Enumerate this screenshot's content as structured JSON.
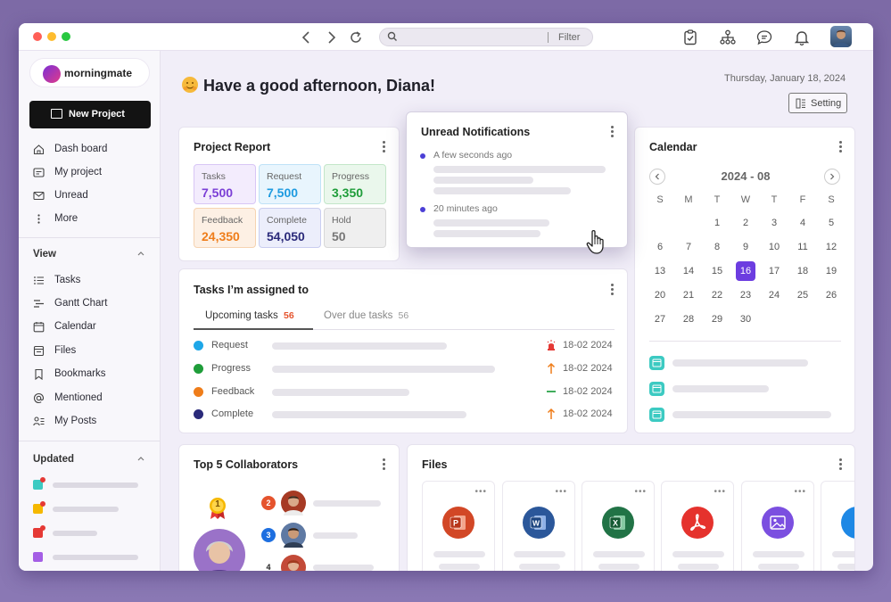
{
  "app": {
    "brand": "morningmate",
    "new_project_label": "New Project",
    "search_placeholder": "",
    "filter_label": "Filter"
  },
  "sidebar": {
    "items": [
      {
        "label": "Dash board",
        "icon": "home-icon"
      },
      {
        "label": "My project",
        "icon": "project-icon"
      },
      {
        "label": "Unread",
        "icon": "mail-icon"
      },
      {
        "label": "More",
        "icon": "more-vertical-icon"
      }
    ],
    "view_title": "View",
    "view_items": [
      {
        "label": "Tasks",
        "icon": "list-icon"
      },
      {
        "label": "Gantt Chart",
        "icon": "gantt-icon"
      },
      {
        "label": "Calendar",
        "icon": "calendar-icon"
      },
      {
        "label": "Files",
        "icon": "file-icon"
      },
      {
        "label": "Bookmarks",
        "icon": "bookmark-icon"
      },
      {
        "label": "Mentioned",
        "icon": "at-icon"
      },
      {
        "label": "My Posts",
        "icon": "posts-icon"
      }
    ],
    "updated_title": "Updated",
    "updated_colors": [
      "#3ccac2",
      "#f5b800",
      "#e53935",
      "#a45ee5"
    ]
  },
  "header": {
    "greeting": "Have a good afternoon, Diana!",
    "date": "Thursday, January 18, 2024",
    "setting_label": "Setting"
  },
  "project_report": {
    "title": "Project Report",
    "stats": [
      {
        "label": "Tasks",
        "value": "7,500",
        "color": "#7b3fd6",
        "bg": "#f3ecfd",
        "border": "#d8c6f5"
      },
      {
        "label": "Request",
        "value": "7,500",
        "color": "#1e9be0",
        "bg": "#e8f5fd",
        "border": "#bfe2f7"
      },
      {
        "label": "Progress",
        "value": "3,350",
        "color": "#1f9d3a",
        "bg": "#eaf7ec",
        "border": "#c3e6c9"
      },
      {
        "label": "Feedback",
        "value": "24,350",
        "color": "#ef7d1a",
        "bg": "#fdf0e4",
        "border": "#f6d3b1"
      },
      {
        "label": "Complete",
        "value": "54,050",
        "color": "#2a2a7a",
        "bg": "#eceefb",
        "border": "#c9cdf0"
      },
      {
        "label": "Hold",
        "value": "50",
        "color": "#777777",
        "bg": "#efefef",
        "border": "#d8d8d8"
      }
    ]
  },
  "notifications": {
    "title": "Unread Notifications",
    "items": [
      {
        "time": "A few seconds ago"
      },
      {
        "time": "20 minutes ago"
      }
    ]
  },
  "tasks": {
    "title": "Tasks I’m assigned to",
    "tab_upcoming": "Upcoming tasks",
    "tab_upcoming_count": "56",
    "tab_overdue": "Over due tasks",
    "tab_overdue_count": "56",
    "rows": [
      {
        "label": "Request",
        "date": "18-02 2024",
        "color": "#1ea7e8",
        "priority": "urgent"
      },
      {
        "label": "Progress",
        "date": "18-02 2024",
        "color": "#1f9d3a",
        "priority": "high"
      },
      {
        "label": "Feedback",
        "date": "18-02 2024",
        "color": "#ef7d1a",
        "priority": "normal"
      },
      {
        "label": "Complete",
        "date": "18-02 2024",
        "color": "#2a2a7a",
        "priority": "high"
      }
    ]
  },
  "calendar": {
    "title": "Calendar",
    "month": "2024 - 08",
    "weekdays": [
      "S",
      "M",
      "T",
      "W",
      "T",
      "F",
      "S"
    ],
    "days": [
      "",
      "",
      "1",
      "2",
      "3",
      "4",
      "5",
      "6",
      "7",
      "8",
      "9",
      "10",
      "11",
      "12",
      "13",
      "14",
      "15",
      "16",
      "17",
      "18",
      "19",
      "20",
      "21",
      "22",
      "23",
      "24",
      "25",
      "26",
      "27",
      "28",
      "29",
      "30"
    ],
    "selected": "16",
    "accent": "#6c3de0"
  },
  "collaborators": {
    "title": "Top 5 Collaborators",
    "ranks": [
      "1",
      "2",
      "3",
      "4"
    ]
  },
  "files": {
    "title": "Files",
    "types": [
      {
        "icon": "powerpoint-icon",
        "color": "#d24726",
        "letter": "P"
      },
      {
        "icon": "word-icon",
        "color": "#2b579a",
        "letter": "W"
      },
      {
        "icon": "excel-icon",
        "color": "#217346",
        "letter": "X"
      },
      {
        "icon": "pdf-icon",
        "color": "#e5322d",
        "letter": "A"
      },
      {
        "icon": "image-icon",
        "color": "#7b4fe0",
        "letter": ""
      },
      {
        "icon": "file-icon",
        "color": "#1e88e5",
        "letter": ""
      }
    ]
  }
}
